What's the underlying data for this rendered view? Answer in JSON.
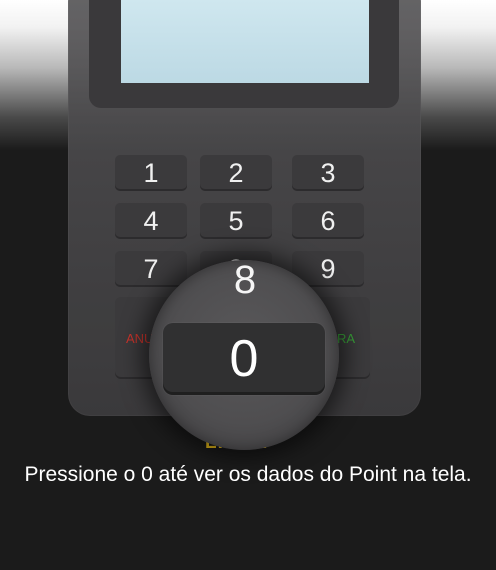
{
  "device": {
    "keypad": [
      [
        "1",
        "2",
        "3"
      ],
      [
        "4",
        "5",
        "6"
      ],
      [
        "7",
        "8",
        "9"
      ]
    ],
    "cancel_label": "ANU",
    "confirm_label": "RA",
    "clear_label": "LIMPA",
    "cancel_color": "#c8342c",
    "confirm_color": "#3aa33a",
    "clear_color": "#f2c31b"
  },
  "magnifier": {
    "partial_key": "8",
    "focus_key": "0"
  },
  "instruction": "Pressione o 0 até ver os dados do Point na tela."
}
